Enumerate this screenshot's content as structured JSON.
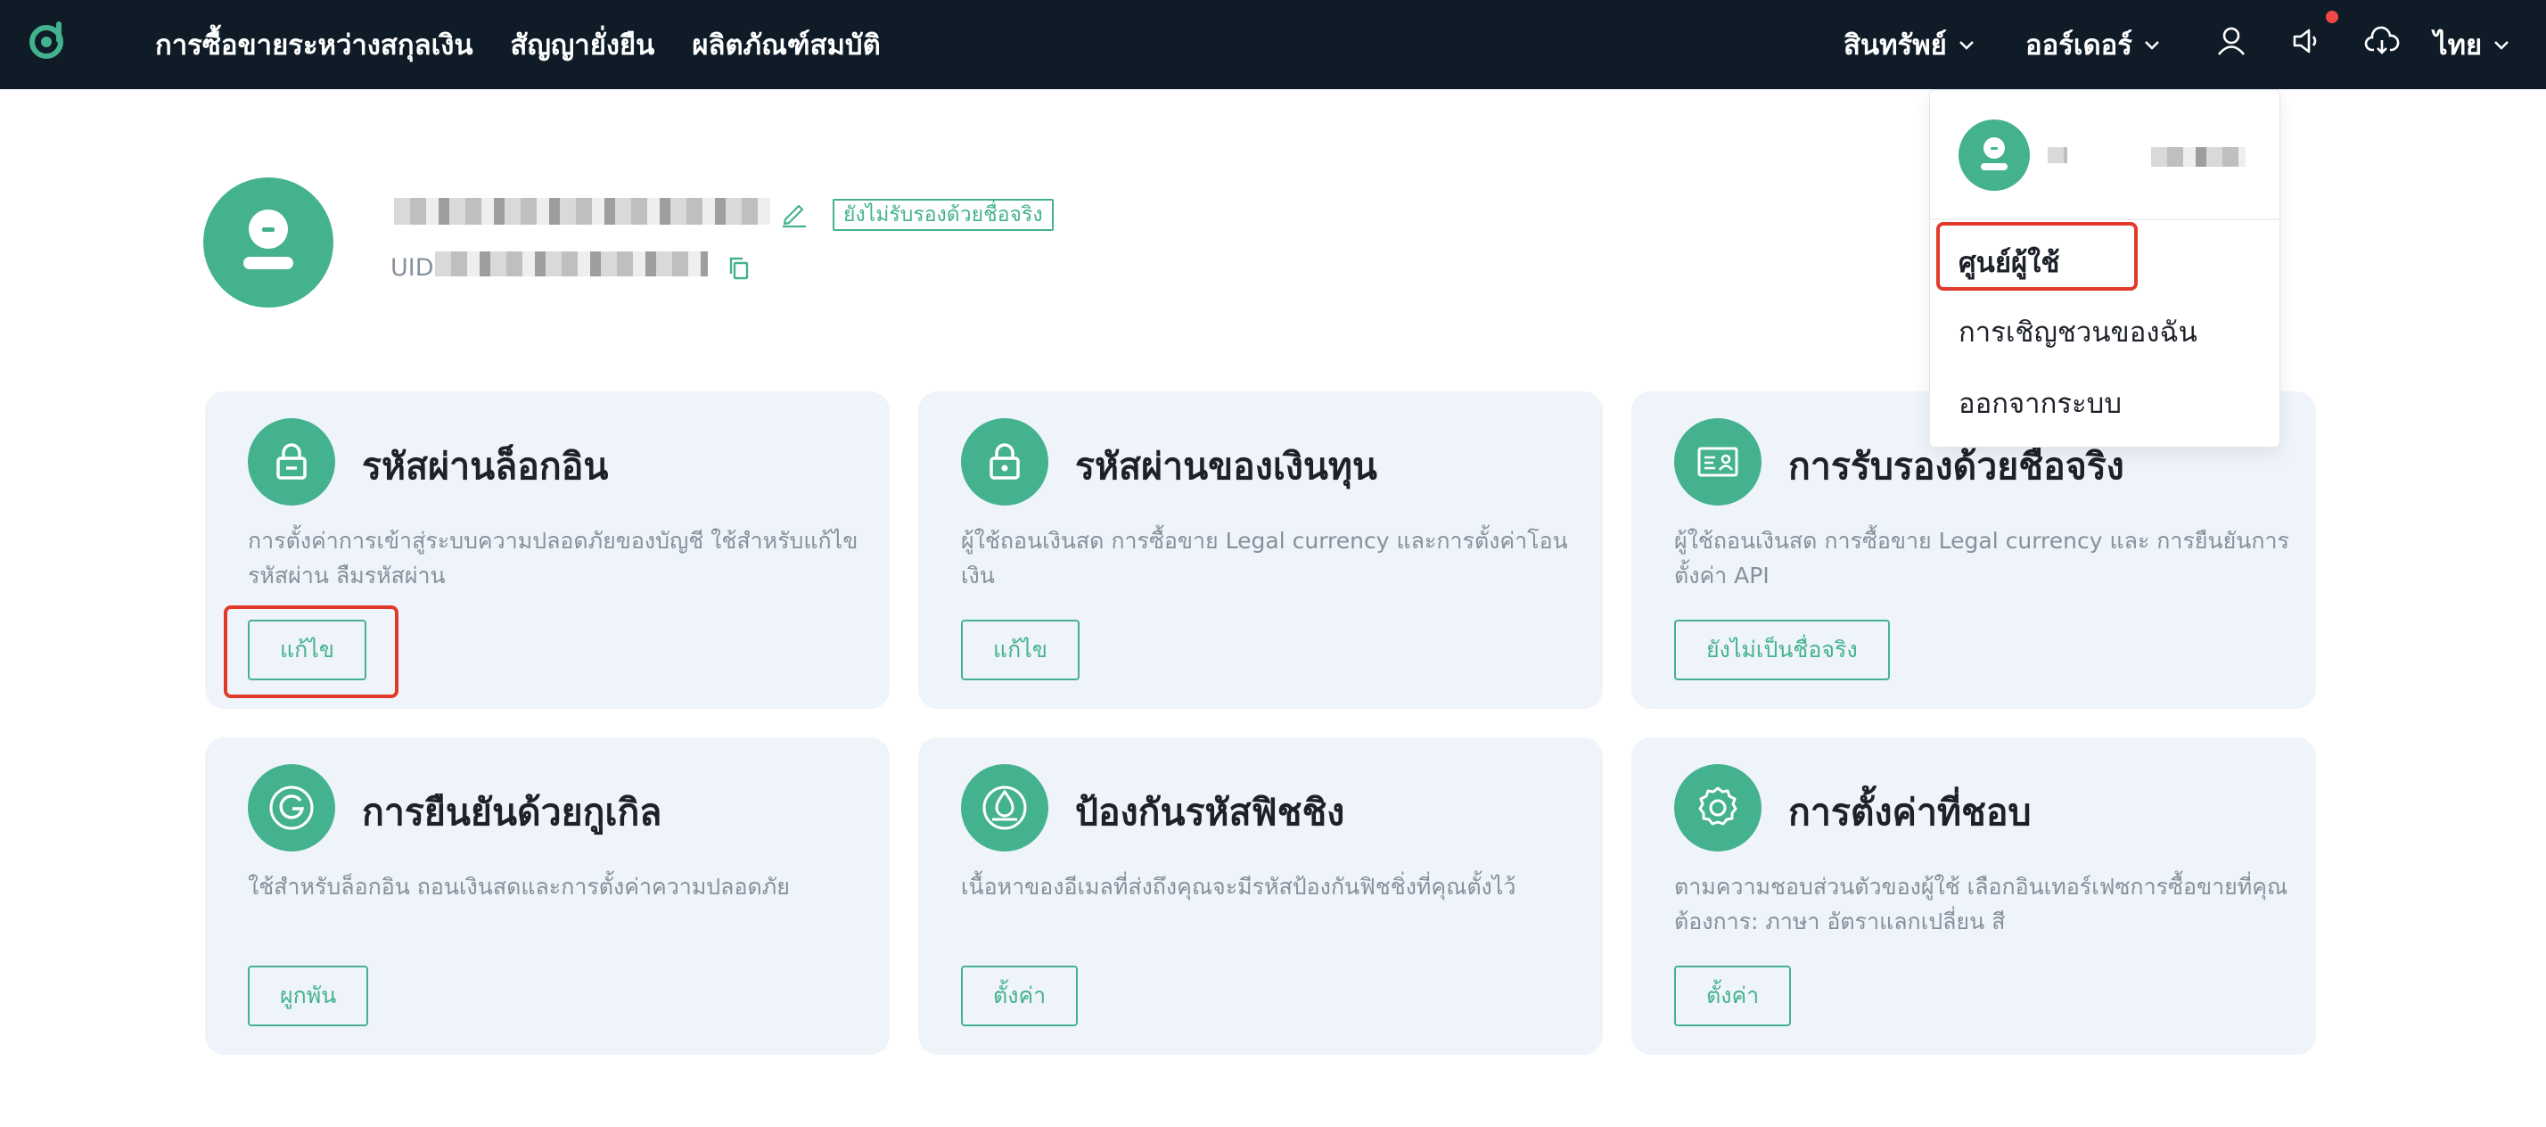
{
  "nav": {
    "main_links": [
      "การซื้อขายระหว่างสกุลเงิน",
      "สัญญายั่งยืน",
      "ผลิตภัณฑ์สมบัติ"
    ],
    "assets_label": "สินทรัพย์",
    "orders_label": "ออร์เดอร์",
    "language_label": "ไทย"
  },
  "profile": {
    "verify_badge": "ยังไม่รับรองด้วยชื่อจริง",
    "uid_label": "UID"
  },
  "cards": [
    {
      "title": "รหัสผ่านล็อกอิน",
      "desc": "การตั้งค่าการเข้าสู่ระบบความปลอดภัยของบัญชี ใช้สำหรับแก้ไขรหัสผ่าน ลืมรหัสผ่าน",
      "button": "แก้ไข",
      "icon": "lock-icon"
    },
    {
      "title": "รหัสผ่านของเงินทุน",
      "desc": "ผู้ใช้ถอนเงินสด การซื้อขาย Legal currency และการตั้งค่าโอนเงิน",
      "button": "แก้ไข",
      "icon": "lock-icon"
    },
    {
      "title": "การรับรองด้วยชื่อจริง",
      "desc": "ผู้ใช้ถอนเงินสด การซื้อขาย Legal currency และ การยืนยันการตั้งค่า API",
      "button": "ยังไม่เป็นชื่อจริง",
      "icon": "id-card-icon"
    },
    {
      "title": "การยืนยันด้วยกูเกิล",
      "desc": "ใช้สำหรับล็อกอิน ถอนเงินสดและการตั้งค่าความปลอดภัย",
      "button": "ผูกพัน",
      "icon": "google-icon"
    },
    {
      "title": "ป้องกันรหัสฟิชชิง",
      "desc": "เนื้อหาของอีเมลที่ส่งถึงคุณจะมีรหัสป้องกันฟิชชิ่งที่คุณตั้งไว้",
      "button": "ตั้งค่า",
      "icon": "anti-phishing-icon"
    },
    {
      "title": "การตั้งค่าที่ชอบ",
      "desc": "ตามความชอบส่วนตัวของผู้ใช้ เลือกอินเทอร์เฟซการซื้อขายที่คุณต้องการ: ภาษา อัตราแลกเปลี่ยน สี",
      "button": "ตั้งค่า",
      "icon": "gear-icon"
    }
  ],
  "dropdown": {
    "items": [
      "ศูนย์ผู้ใช้",
      "การเชิญชวนของฉัน",
      "ออกจากระบบ"
    ]
  },
  "colors": {
    "navbar": "#0f1c28",
    "accent": "#45b28f",
    "card_bg": "#eef4fa",
    "highlight": "#e23a2a",
    "notification_dot": "#f04848"
  }
}
